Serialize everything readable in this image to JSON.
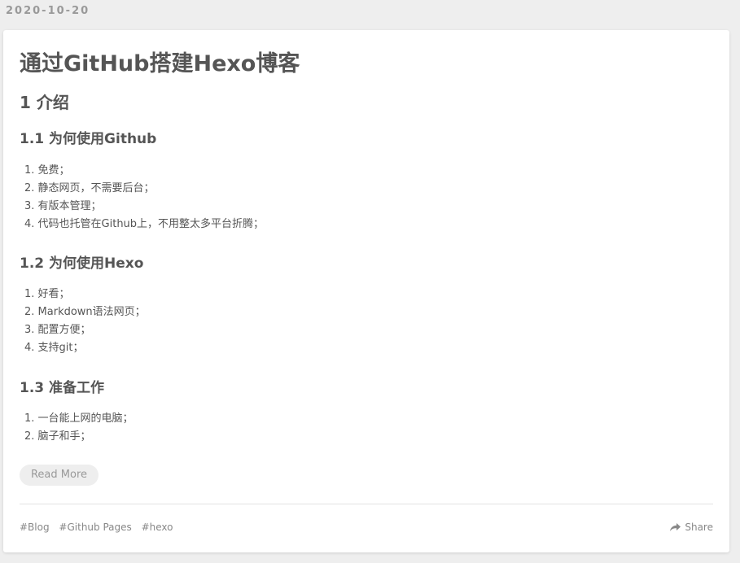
{
  "post": {
    "date": "2020-10-20",
    "title": "通过GitHub搭建Hexo博客",
    "section_title": "1 介绍",
    "subsections": [
      {
        "heading": "1.1 为何使用Github",
        "items": [
          "1. 免费；",
          "2. 静态网页，不需要后台；",
          "3. 有版本管理；",
          "4. 代码也托管在Github上，不用整太多平台折腾；"
        ]
      },
      {
        "heading": "1.2 为何使用Hexo",
        "items": [
          "1. 好看；",
          "2. Markdown语法网页；",
          "3. 配置方便；",
          "4. 支持git；"
        ]
      },
      {
        "heading": "1.3 准备工作",
        "items": [
          "1. 一台能上网的电脑；",
          "2. 脑子和手；"
        ]
      }
    ],
    "read_more_label": "Read More",
    "tags": [
      "#Blog",
      "#Github Pages",
      "#hexo"
    ],
    "share_label": "Share",
    "share_icon": "share-icon"
  }
}
